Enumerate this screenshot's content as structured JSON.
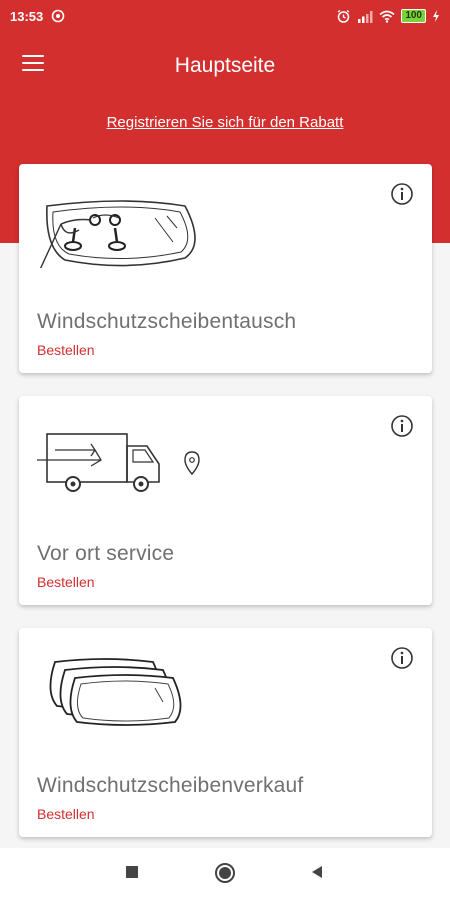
{
  "status_bar": {
    "time": "13:53",
    "battery": "100"
  },
  "app_bar": {
    "title": "Hauptseite"
  },
  "promo": {
    "label": "Registrieren Sie sich für den Rabatt"
  },
  "cards": [
    {
      "name": "Windschutzscheibentausch",
      "action": "Bestellen",
      "icon": "windshield-replacement-icon"
    },
    {
      "name": "Vor ort service",
      "action": "Bestellen",
      "icon": "delivery-truck-icon"
    },
    {
      "name": "Windschutzscheibenverkauf",
      "action": "Bestellen",
      "icon": "windshield-stack-icon"
    }
  ],
  "colors": {
    "primary": "#d32f2f",
    "background": "#f5f5f5",
    "card": "#ffffff",
    "text_muted": "#707070"
  },
  "nav": {
    "buttons": [
      "recent-apps-icon",
      "home-icon",
      "back-icon"
    ]
  }
}
